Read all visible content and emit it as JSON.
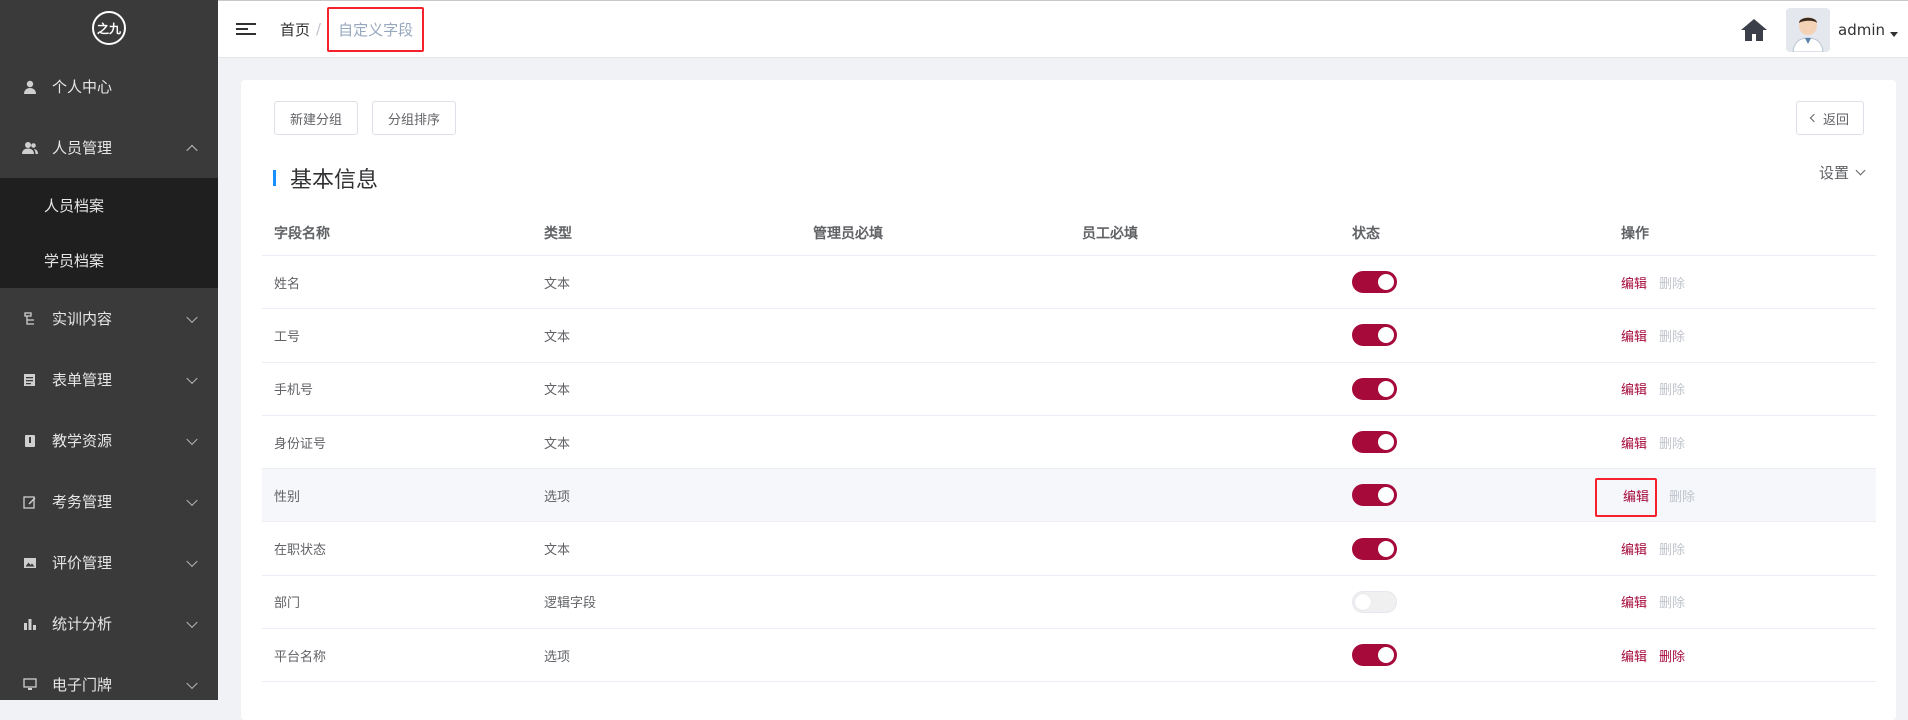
{
  "logo": {
    "text": "之九"
  },
  "sidebar": {
    "items": [
      {
        "label": "个人中心",
        "icon": "user-icon",
        "expandable": false
      },
      {
        "label": "人员管理",
        "icon": "users-icon",
        "expandable": true,
        "expanded": true,
        "children": [
          {
            "label": "人员档案"
          },
          {
            "label": "学员档案"
          }
        ]
      },
      {
        "label": "实训内容",
        "icon": "tree-icon",
        "expandable": true
      },
      {
        "label": "表单管理",
        "icon": "form-icon",
        "expandable": true
      },
      {
        "label": "教学资源",
        "icon": "book-icon",
        "expandable": true
      },
      {
        "label": "考务管理",
        "icon": "edit-doc-icon",
        "expandable": true
      },
      {
        "label": "评价管理",
        "icon": "picture-icon",
        "expandable": true
      },
      {
        "label": "统计分析",
        "icon": "bar-chart-icon",
        "expandable": true
      },
      {
        "label": "电子门牌",
        "icon": "monitor-icon",
        "expandable": true
      }
    ]
  },
  "topbar": {
    "breadcrumb": {
      "home": "首页",
      "separator": "/",
      "current": "自定义字段"
    },
    "user": "admin"
  },
  "toolbar": {
    "new_group": "新建分组",
    "group_sort": "分组排序",
    "back": "返回"
  },
  "section": {
    "title": "基本信息",
    "settings": "设置"
  },
  "table": {
    "headers": [
      "字段名称",
      "类型",
      "管理员必填",
      "员工必填",
      "状态",
      "操作"
    ],
    "edit_label": "编辑",
    "delete_label": "删除",
    "rows": [
      {
        "name": "姓名",
        "type": "文本",
        "status_on": true,
        "delete_enabled": false
      },
      {
        "name": "工号",
        "type": "文本",
        "status_on": true,
        "delete_enabled": false
      },
      {
        "name": "手机号",
        "type": "文本",
        "status_on": true,
        "delete_enabled": false
      },
      {
        "name": "身份证号",
        "type": "文本",
        "status_on": true,
        "delete_enabled": false
      },
      {
        "name": "性别",
        "type": "选项",
        "status_on": true,
        "delete_enabled": false
      },
      {
        "name": "在职状态",
        "type": "文本",
        "status_on": true,
        "delete_enabled": false
      },
      {
        "name": "部门",
        "type": "逻辑字段",
        "status_on": false,
        "delete_enabled": false
      },
      {
        "name": "平台名称",
        "type": "选项",
        "status_on": true,
        "delete_enabled": true
      }
    ]
  },
  "colors": {
    "accent": "#a50a3b",
    "sidebar_bg": "#3a3a3a",
    "submenu_bg": "#1f1f1f",
    "title_bar": "#1890ff"
  }
}
